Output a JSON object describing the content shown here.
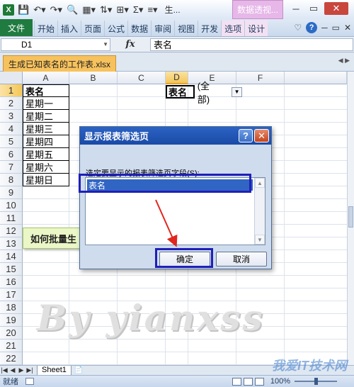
{
  "qat": {
    "logo": "X",
    "doc_title_abbrev": "生...",
    "context_header": "数据透视...",
    "icons": [
      "save-icon",
      "undo-icon",
      "redo-icon",
      "print-preview-icon",
      "layout-icon",
      "sort-icon",
      "border-icon",
      "sum-icon",
      "align-icon"
    ]
  },
  "ribbon": {
    "file": "文件",
    "tabs": [
      "开始",
      "插入",
      "页面",
      "公式",
      "数据",
      "审阅",
      "视图",
      "开发",
      "选项",
      "设计"
    ]
  },
  "formula_bar": {
    "name_box": "D1",
    "fx": "fx",
    "value": "表名"
  },
  "workbook": {
    "tab_name": "生成已知表名的工作表.xlsx"
  },
  "columns": [
    "A",
    "B",
    "C",
    "D",
    "E",
    "F"
  ],
  "rows": [
    "1",
    "2",
    "3",
    "4",
    "5",
    "6",
    "7",
    "8",
    "9",
    "10",
    "11",
    "12",
    "13",
    "14",
    "15",
    "16",
    "17",
    "18",
    "19",
    "20",
    "21",
    "22"
  ],
  "cells": {
    "A": [
      "表名",
      "星期一",
      "星期二",
      "星期三",
      "星期四",
      "星期五",
      "星期六",
      "星期日"
    ]
  },
  "pivot": {
    "field": "表名",
    "value": "(全部)"
  },
  "note": "如何批量生",
  "watermark": "By yianxss",
  "dialog": {
    "title": "显示报表筛选页",
    "prompt": "选定要显示的报表筛选页字段(S):",
    "items": [
      "表名"
    ],
    "ok": "确定",
    "cancel": "取消"
  },
  "sheet_tabs": [
    "Sheet1"
  ],
  "status": {
    "ready": "就绪",
    "zoom": "100%"
  },
  "site_mark": "我爱IT技术网"
}
